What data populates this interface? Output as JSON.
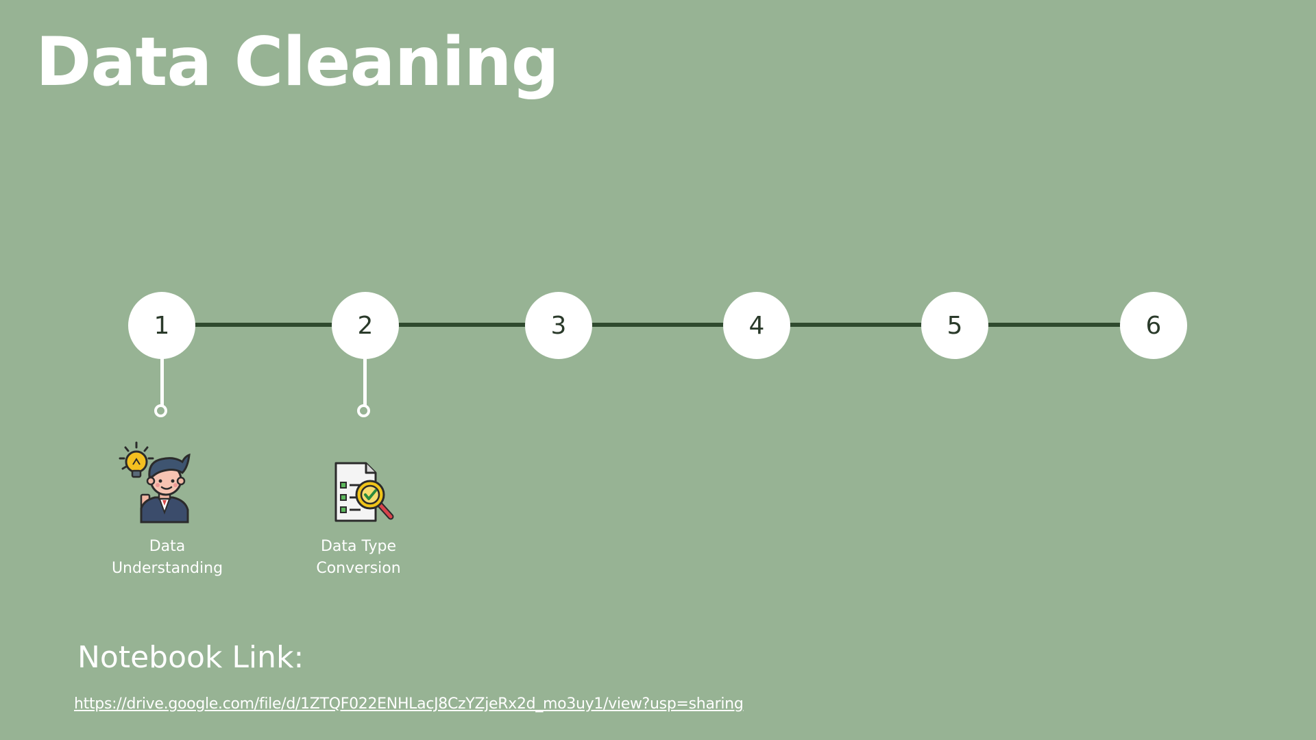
{
  "title": "Data Cleaning",
  "steps": [
    {
      "number": "1",
      "label_line1": "Data",
      "label_line2": "Understanding",
      "icon": "idea-person-icon"
    },
    {
      "number": "2",
      "label_line1": "Data Type",
      "label_line2": "Conversion",
      "icon": "document-check-icon"
    },
    {
      "number": "3"
    },
    {
      "number": "4"
    },
    {
      "number": "5"
    },
    {
      "number": "6"
    }
  ],
  "notebook": {
    "heading": "Notebook Link:",
    "url": "https://drive.google.com/file/d/1ZTQF022ENHLacJ8CzYZjeRx2d_mo3uy1/view?usp=sharing"
  },
  "colors": {
    "background": "#97b394",
    "timeline": "#2f4a2e",
    "circle": "#ffffff",
    "text": "#ffffff"
  }
}
